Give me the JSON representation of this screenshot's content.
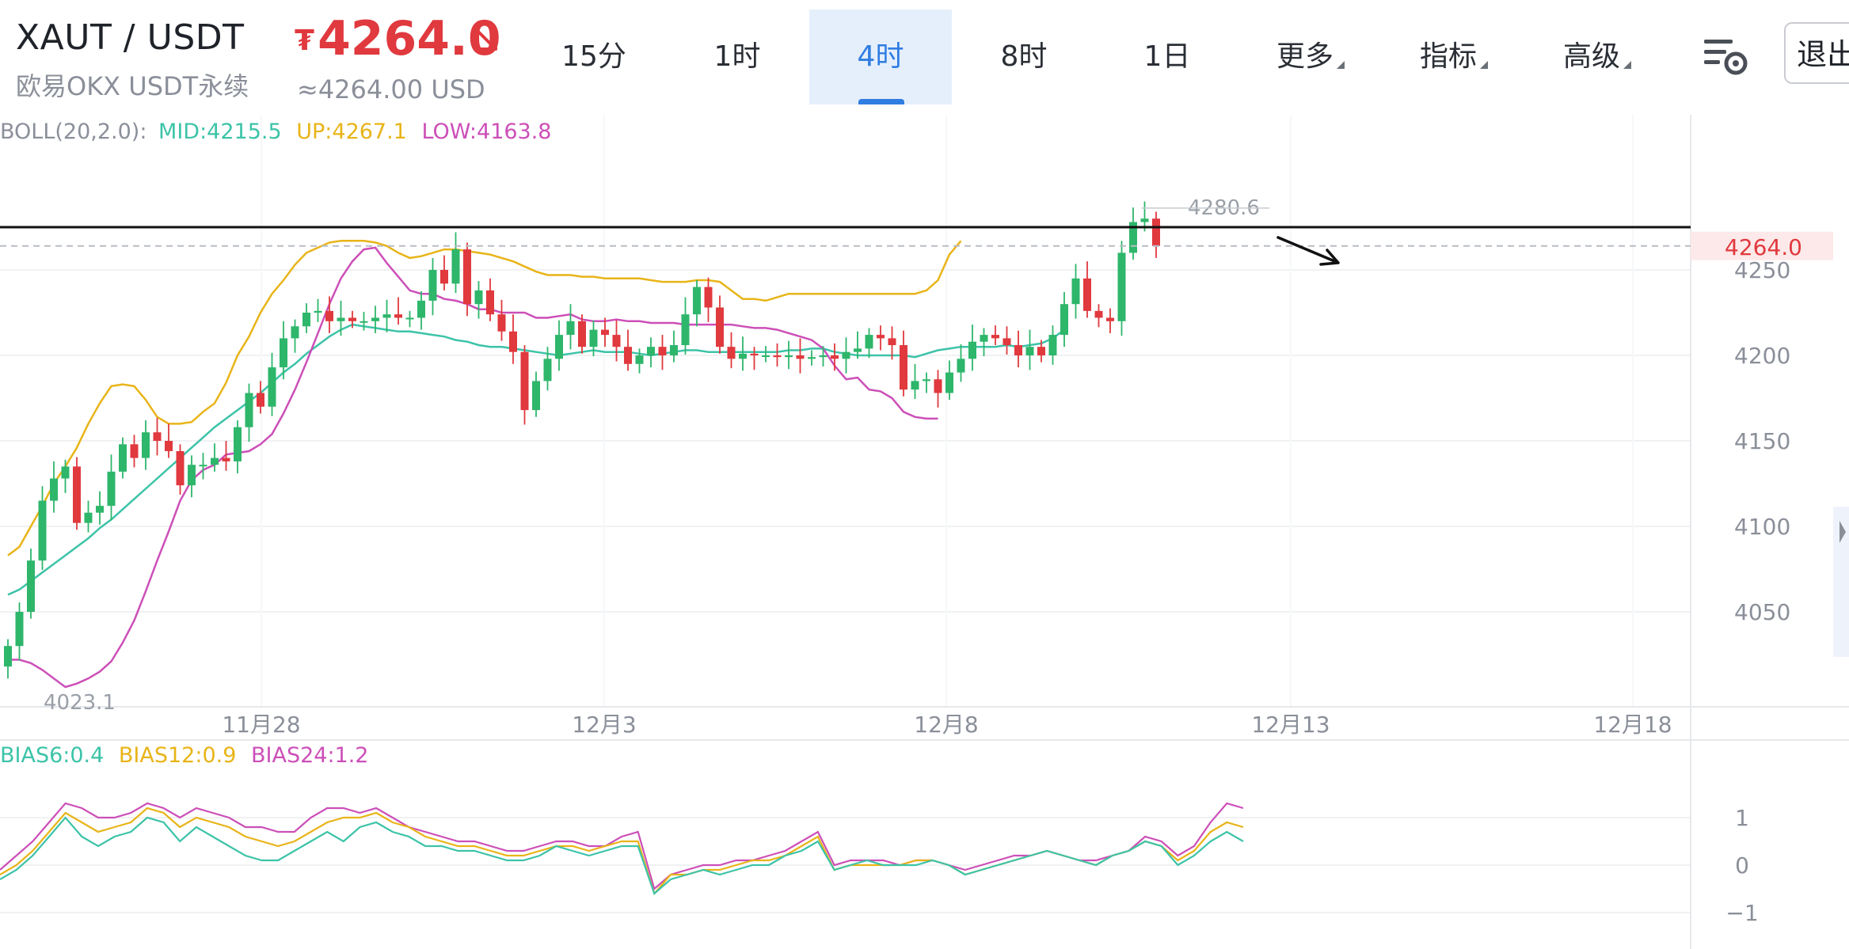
{
  "header": {
    "pair": "XAUT / USDT",
    "exchange": "欧易OKX USDT永续",
    "currency_symbol": "₮",
    "price": "4264.0",
    "usd_price": "≈4264.00 USD",
    "exit_label": "退出",
    "tabs": [
      {
        "label": "15分",
        "active": false,
        "dropdown": false
      },
      {
        "label": "1时",
        "active": false,
        "dropdown": false
      },
      {
        "label": "4时",
        "active": true,
        "dropdown": false
      },
      {
        "label": "8时",
        "active": false,
        "dropdown": false
      },
      {
        "label": "1日",
        "active": false,
        "dropdown": false
      },
      {
        "label": "更多",
        "active": false,
        "dropdown": true
      },
      {
        "label": "指标",
        "active": false,
        "dropdown": true
      },
      {
        "label": "高级",
        "active": false,
        "dropdown": true
      }
    ]
  },
  "colors": {
    "up": "#2eb66b",
    "down": "#e0393e",
    "mid": "#3cc3a8",
    "upper": "#e8b418",
    "lower": "#cc4fb8",
    "active_tab": "#2f7de1"
  },
  "chart_data": {
    "type": "candlestick",
    "boll_legend": {
      "name": "BOLL(20,2.0):",
      "mid": "MID:4215.5",
      "up": "UP:4267.1",
      "low": "LOW:4163.8"
    },
    "bias_legend": {
      "b6": "BIAS6:0.4",
      "b12": "BIAS12:0.9",
      "b24": "BIAS24:1.2"
    },
    "last_price_tag": "4264.0",
    "high_label": "4280.6",
    "low_label": "4023.1",
    "x_tick_labels": [
      "11月28",
      "12月3",
      "12月8",
      "12月13",
      "12月18"
    ],
    "y_ticks": [
      4050,
      4100,
      4150,
      4200,
      4250
    ],
    "y_tick_labels": [
      "4050",
      "4100",
      "4150",
      "4200",
      "4250"
    ],
    "bias_ticks": [
      1,
      0,
      -1
    ],
    "bias_tick_labels": [
      "1",
      "0",
      "−1"
    ],
    "resistance_line": 4275,
    "closes": [
      4030,
      4050,
      4080,
      4115,
      4128,
      4135,
      4102,
      4108,
      4112,
      4132,
      4148,
      4140,
      4155,
      4150,
      4144,
      4124,
      4136,
      4136,
      4140,
      4138,
      4158,
      4178,
      4170,
      4193,
      4210,
      4217,
      4225,
      4226,
      4220,
      4222,
      4220,
      4220,
      4222,
      4224,
      4222,
      4222,
      4232,
      4250,
      4242,
      4262,
      4230,
      4238,
      4224,
      4214,
      4202,
      4168,
      4185,
      4198,
      4212,
      4220,
      4205,
      4215,
      4212,
      4205,
      4195,
      4200,
      4205,
      4200,
      4206,
      4224,
      4240,
      4228,
      4205,
      4198,
      4201,
      4200,
      4200,
      4199,
      4200,
      4198,
      4199,
      4200,
      4198,
      4202,
      4204,
      4212,
      4210,
      4206,
      4180,
      4185,
      4186,
      4178,
      4190,
      4198,
      4208,
      4212,
      4210,
      4206,
      4200,
      4205,
      4200,
      4212,
      4230,
      4245,
      4226,
      4222,
      4220,
      4260,
      4278,
      4280,
      4264
    ],
    "boll_mid": [
      4060,
      4063,
      4068,
      4073,
      4078,
      4083,
      4088,
      4093,
      4099,
      4104,
      4110,
      4116,
      4122,
      4128,
      4134,
      4140,
      4146,
      4152,
      4158,
      4163,
      4168,
      4173,
      4178,
      4184,
      4190,
      4195,
      4201,
      4206,
      4211,
      4215,
      4218,
      4217,
      4216,
      4215,
      4214,
      4214,
      4213,
      4212,
      4211,
      4209,
      4208,
      4206,
      4205,
      4205,
      4204,
      4203,
      4202,
      4201,
      4200,
      4201,
      4202,
      4203,
      4202,
      4202,
      4202,
      4201,
      4200,
      4201,
      4202,
      4203,
      4203,
      4202,
      4202,
      4202,
      4202,
      4202,
      4202,
      4202,
      4203,
      4203,
      4204,
      4204,
      4202,
      4201,
      4200,
      4200,
      4200,
      4200,
      4200,
      4199,
      4201,
      4203,
      4204,
      4205,
      4205,
      4205,
      4205,
      4206,
      4205,
      4206,
      4207,
      4210,
      4215
    ],
    "boll_up": [
      4083,
      4088,
      4100,
      4112,
      4125,
      4135,
      4146,
      4160,
      4172,
      4182,
      4183,
      4182,
      4174,
      4164,
      4160,
      4160,
      4161,
      4167,
      4172,
      4184,
      4200,
      4211,
      4225,
      4236,
      4244,
      4253,
      4260,
      4263,
      4266,
      4267,
      4267,
      4267,
      4266,
      4264,
      4260,
      4257,
      4258,
      4260,
      4262,
      4262,
      4261,
      4260,
      4259,
      4257,
      4255,
      4252,
      4249,
      4247,
      4247,
      4247,
      4246,
      4246,
      4245,
      4245,
      4245,
      4245,
      4244,
      4243,
      4243,
      4243,
      4244,
      4244,
      4243,
      4238,
      4233,
      4233,
      4232,
      4234,
      4236,
      4236,
      4236,
      4236,
      4236,
      4236,
      4236,
      4236,
      4236,
      4236,
      4236,
      4236,
      4238,
      4244,
      4259,
      4267
    ],
    "boll_low": [
      4022,
      4022,
      4020,
      4016,
      4011,
      4006,
      4008,
      4011,
      4015,
      4021,
      4032,
      4045,
      4062,
      4080,
      4097,
      4115,
      4127,
      4133,
      4136,
      4142,
      4143,
      4144,
      4148,
      4154,
      4166,
      4180,
      4196,
      4213,
      4230,
      4245,
      4255,
      4262,
      4263,
      4254,
      4246,
      4238,
      4236,
      4236,
      4233,
      4232,
      4230,
      4227,
      4227,
      4225,
      4225,
      4225,
      4222,
      4222,
      4223,
      4224,
      4221,
      4220,
      4220,
      4221,
      4220,
      4220,
      4219,
      4219,
      4219,
      4218,
      4218,
      4218,
      4218,
      4218,
      4217,
      4216,
      4216,
      4215,
      4213,
      4211,
      4209,
      4204,
      4194,
      4186,
      4187,
      4180,
      4179,
      4175,
      4167,
      4164,
      4163,
      4163
    ],
    "bias6": [
      -0.3,
      -0.1,
      0.2,
      0.6,
      1.0,
      0.6,
      0.4,
      0.6,
      0.7,
      1.0,
      0.9,
      0.5,
      0.8,
      0.6,
      0.4,
      0.2,
      0.1,
      0.1,
      0.3,
      0.5,
      0.7,
      0.5,
      0.8,
      0.9,
      0.7,
      0.6,
      0.4,
      0.4,
      0.3,
      0.3,
      0.2,
      0.1,
      0.1,
      0.2,
      0.4,
      0.3,
      0.2,
      0.3,
      0.4,
      0.4,
      -0.6,
      -0.3,
      -0.2,
      -0.1,
      -0.2,
      -0.1,
      0.0,
      0.0,
      0.2,
      0.3,
      0.5,
      -0.1,
      0.0,
      0.1,
      0.0,
      0.0,
      0.0,
      0.1,
      0.0,
      -0.2,
      -0.1,
      0.0,
      0.1,
      0.2,
      0.3,
      0.2,
      0.1,
      0.0,
      0.2,
      0.3,
      0.5,
      0.4,
      0.0,
      0.2,
      0.5,
      0.7,
      0.5
    ],
    "bias12": [
      -0.2,
      0.0,
      0.3,
      0.7,
      1.1,
      0.9,
      0.7,
      0.8,
      0.9,
      1.2,
      1.1,
      0.8,
      1.0,
      0.9,
      0.8,
      0.6,
      0.5,
      0.4,
      0.5,
      0.7,
      0.9,
      1.0,
      1.0,
      1.1,
      0.9,
      0.8,
      0.6,
      0.5,
      0.4,
      0.4,
      0.3,
      0.2,
      0.2,
      0.3,
      0.4,
      0.4,
      0.3,
      0.4,
      0.5,
      0.5,
      -0.6,
      -0.2,
      -0.2,
      -0.1,
      -0.1,
      0.0,
      0.1,
      0.1,
      0.2,
      0.4,
      0.6,
      -0.1,
      0.0,
      0.0,
      0.0,
      0.0,
      0.1,
      0.1,
      0.0,
      -0.2,
      -0.1,
      0.0,
      0.1,
      0.2,
      0.3,
      0.2,
      0.1,
      0.0,
      0.2,
      0.3,
      0.5,
      0.4,
      0.1,
      0.3,
      0.7,
      0.9,
      0.8
    ],
    "bias24": [
      -0.1,
      0.2,
      0.5,
      0.9,
      1.3,
      1.2,
      1.0,
      1.0,
      1.1,
      1.3,
      1.2,
      1.0,
      1.2,
      1.1,
      1.0,
      0.8,
      0.8,
      0.7,
      0.7,
      1.0,
      1.2,
      1.2,
      1.1,
      1.2,
      1.0,
      0.8,
      0.7,
      0.6,
      0.5,
      0.5,
      0.4,
      0.3,
      0.3,
      0.4,
      0.5,
      0.5,
      0.4,
      0.4,
      0.6,
      0.7,
      -0.5,
      -0.2,
      -0.1,
      0.0,
      0.0,
      0.1,
      0.1,
      0.2,
      0.3,
      0.5,
      0.7,
      0.0,
      0.1,
      0.1,
      0.1,
      0.0,
      0.1,
      0.1,
      0.0,
      -0.1,
      0.0,
      0.1,
      0.2,
      0.2,
      0.3,
      0.2,
      0.1,
      0.1,
      0.2,
      0.3,
      0.6,
      0.5,
      0.2,
      0.4,
      0.9,
      1.3,
      1.2
    ]
  }
}
